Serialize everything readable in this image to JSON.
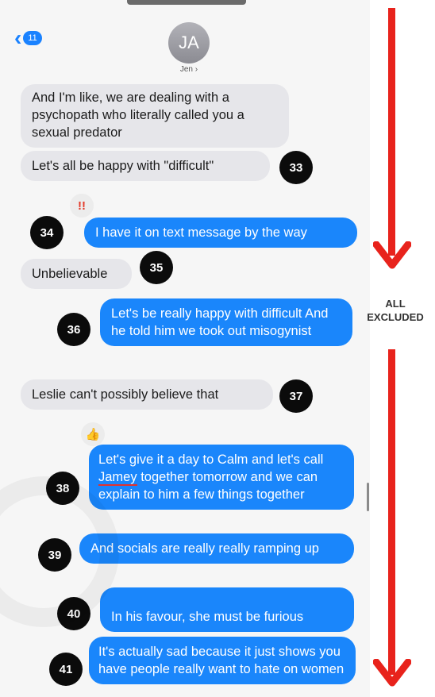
{
  "header": {
    "back_count": "11",
    "avatar_initials": "JA",
    "contact_name": "Jen",
    "contact_chevron": "›"
  },
  "messages": [
    {
      "side": "received",
      "text": "And I'm like, we are dealing with a psychopath who literally called you a sexual predator"
    },
    {
      "side": "received",
      "text": "Let's all be happy with \"difficult\"",
      "number": "33"
    },
    {
      "side": "sent",
      "text": "I have it on text message by the way",
      "number": "34",
      "reaction": "!!"
    },
    {
      "side": "received",
      "text": "Unbelievable",
      "number": "35"
    },
    {
      "side": "sent",
      "text": "Let's be really happy with difficult And he told him we took out misogynist",
      "number": "36"
    },
    {
      "side": "received",
      "text": "Leslie can't possibly believe that",
      "number": "37"
    },
    {
      "side": "sent",
      "text_before": "Let's give it a day to Calm and let's call",
      "underlined": "Jamey",
      "text_after": "together tomorrow and we can explain to him a few things together",
      "number": "38",
      "reaction": "👍"
    },
    {
      "side": "sent",
      "text": "And socials are really really ramping up",
      "number": "39"
    },
    {
      "side": "sent",
      "text": "In his favour, she must be furious",
      "number": "40"
    },
    {
      "side": "sent",
      "text": "It's actually sad because it just shows you have people really want to hate on women",
      "number": "41"
    }
  ],
  "annotation": {
    "label_line1": "ALL",
    "label_line2": "EXCLUDED",
    "arrow_color": "#e8231c"
  },
  "colors": {
    "sent_bubble": "#1a86fb",
    "received_bubble": "#e6e6ea",
    "badge": "#0b0b0b"
  },
  "icons": {
    "back": "chevron-left-icon",
    "reaction_34": "exclamation-reaction-icon",
    "reaction_38": "thumbs-up-reaction-icon"
  }
}
